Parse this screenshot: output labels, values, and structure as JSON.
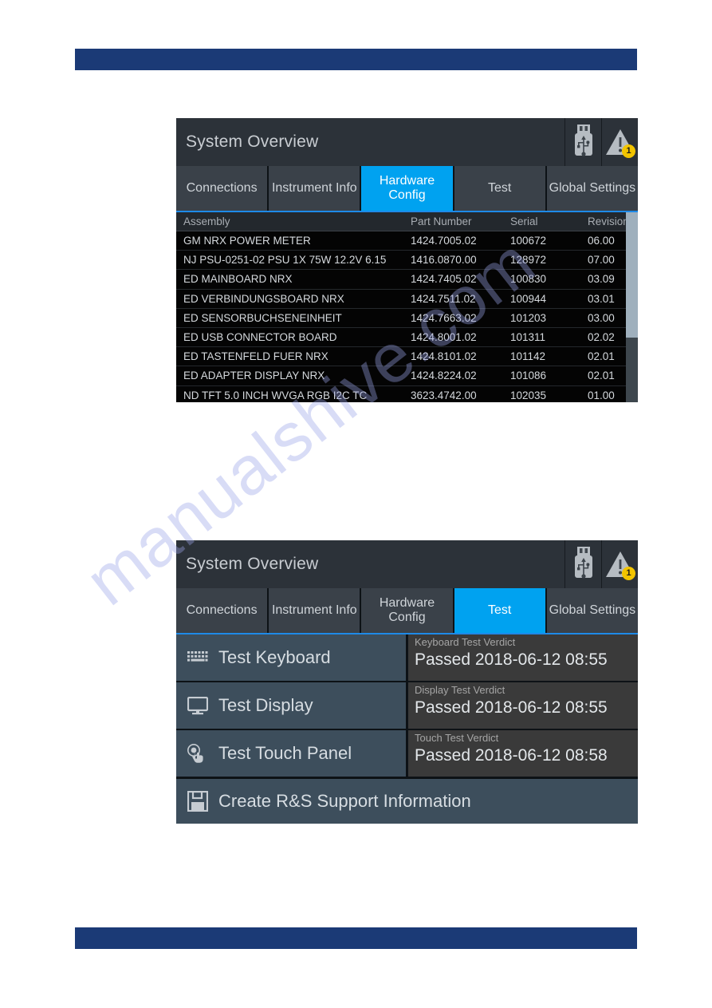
{
  "page": {
    "accent_blue_bar": "#1b3a76",
    "watermark": "manualshive.com"
  },
  "screens": [
    {
      "id": "hardware-config",
      "title": "System Overview",
      "status_icons": [
        {
          "name": "usb-stick-icon",
          "badge": null
        },
        {
          "name": "warning-triangle-icon",
          "badge": "1",
          "badge_color": "#f2c400"
        }
      ],
      "tabs": [
        {
          "label": "Connections",
          "active": false
        },
        {
          "label": "Instrument Info",
          "active": false
        },
        {
          "label": "Hardware Config",
          "active": true
        },
        {
          "label": "Test",
          "active": false
        },
        {
          "label": "Global Settings",
          "active": false
        }
      ],
      "table": {
        "columns": [
          "Assembly",
          "Part Number",
          "Serial",
          "Revision"
        ],
        "rows": [
          [
            "GM NRX POWER METER",
            "1424.7005.02",
            "100672",
            "06.00"
          ],
          [
            "NJ PSU-0251-02 PSU 1X 75W 12.2V 6.15",
            "1416.0870.00",
            "128972",
            "07.00"
          ],
          [
            "ED MAINBOARD NRX",
            "1424.7405.02",
            "100830",
            "03.09"
          ],
          [
            "ED VERBINDUNGSBOARD NRX",
            "1424.7511.02",
            "100944",
            "03.01"
          ],
          [
            "ED SENSORBUCHSENEINHEIT",
            "1424.7663.02",
            "101203",
            "03.00"
          ],
          [
            "ED USB CONNECTOR BOARD",
            "1424.8001.02",
            "101311",
            "02.02"
          ],
          [
            "ED TASTENFELD FUER NRX",
            "1424.8101.02",
            "101142",
            "02.01"
          ],
          [
            "ED ADAPTER DISPLAY NRX",
            "1424.8224.02",
            "101086",
            "02.01"
          ],
          [
            "ND TFT 5.0 INCH WVGA RGB I2C TC",
            "3623.4742.00",
            "102035",
            "01.00"
          ]
        ],
        "scrollbar": {
          "thumb_fraction": "66%"
        }
      }
    },
    {
      "id": "test",
      "title": "System Overview",
      "status_icons": [
        {
          "name": "usb-stick-icon",
          "badge": null
        },
        {
          "name": "warning-triangle-icon",
          "badge": "1",
          "badge_color": "#f2c400"
        }
      ],
      "tabs": [
        {
          "label": "Connections",
          "active": false
        },
        {
          "label": "Instrument Info",
          "active": false
        },
        {
          "label": "Hardware Config",
          "active": false
        },
        {
          "label": "Test",
          "active": true
        },
        {
          "label": "Global Settings",
          "active": false
        }
      ],
      "tests": [
        {
          "icon": "keyboard-icon",
          "button_label": "Test Keyboard",
          "verdict_label": "Keyboard Test Verdict",
          "verdict_value": "Passed 2018-06-12 08:55"
        },
        {
          "icon": "monitor-icon",
          "button_label": "Test Display",
          "verdict_label": "Display Test Verdict",
          "verdict_value": "Passed 2018-06-12 08:55"
        },
        {
          "icon": "touch-hand-icon",
          "button_label": "Test Touch Panel",
          "verdict_label": "Touch Test Verdict",
          "verdict_value": "Passed 2018-06-12 08:58"
        }
      ],
      "support": {
        "icon": "floppy-save-icon",
        "label": "Create R&S Support Information"
      }
    }
  ]
}
